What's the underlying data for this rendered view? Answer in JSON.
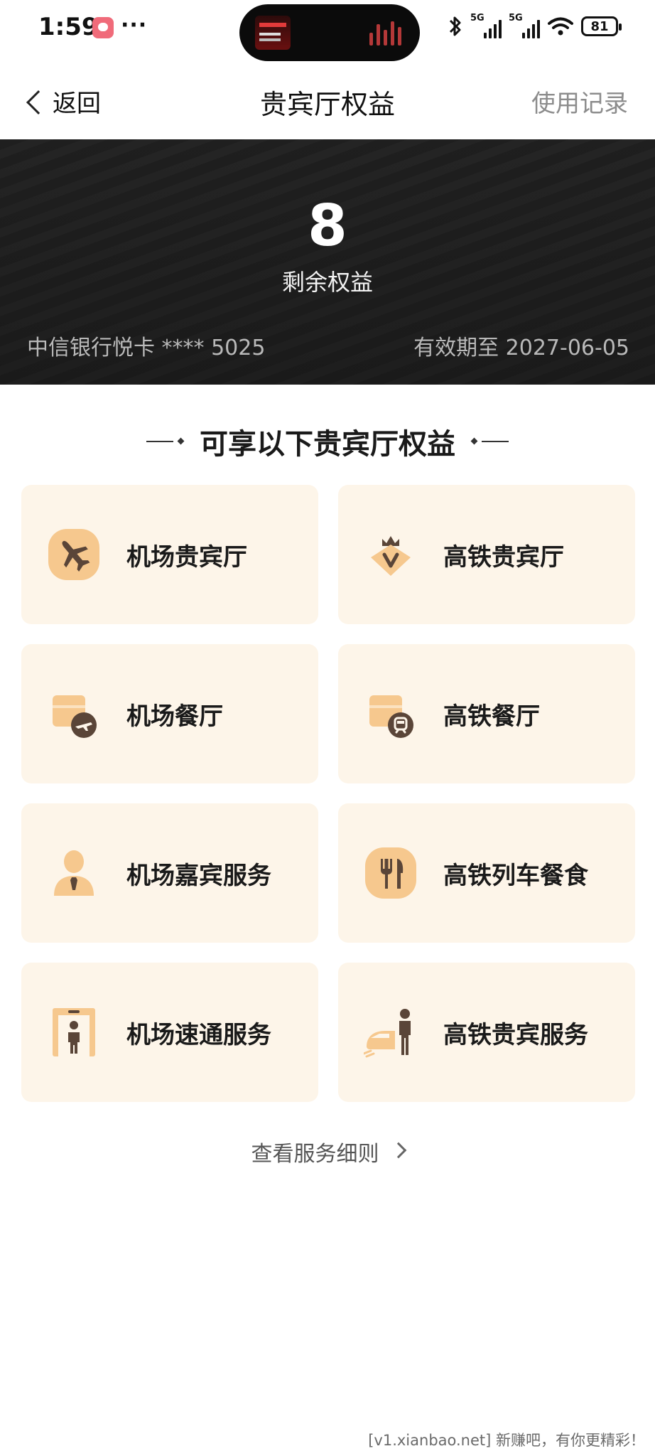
{
  "status_bar": {
    "time": "1:59",
    "more": "···",
    "signal_1": "5G",
    "signal_2": "5G",
    "battery": "81",
    "icons": [
      "bluetooth-icon",
      "signal-icon",
      "wifi-icon",
      "battery-icon"
    ]
  },
  "nav": {
    "back_label": "返回",
    "title": "贵宾厅权益",
    "right_link": "使用记录"
  },
  "summary": {
    "remaining_count": "8",
    "remaining_label": "剩余权益",
    "card_info": "中信银行悦卡 **** 5025",
    "expiry": "有效期至 2027-06-05"
  },
  "section": {
    "title": "可享以下贵宾厅权益"
  },
  "benefits": [
    {
      "label": "机场贵宾厅",
      "icon": "airplane-icon"
    },
    {
      "label": "高铁贵宾厅",
      "icon": "v-crown-icon"
    },
    {
      "label": "机场餐厅",
      "icon": "restaurant-plane-icon"
    },
    {
      "label": "高铁餐厅",
      "icon": "restaurant-train-icon"
    },
    {
      "label": "机场嘉宾服务",
      "icon": "concierge-person-icon"
    },
    {
      "label": "高铁列车餐食",
      "icon": "fork-knife-icon"
    },
    {
      "label": "机场速通服务",
      "icon": "fast-track-gate-icon"
    },
    {
      "label": "高铁贵宾服务",
      "icon": "train-person-icon"
    }
  ],
  "footer": {
    "rules_link": "查看服务细则"
  },
  "watermark": "[v1.xianbao.net] 新赚吧，有你更精彩！",
  "colors": {
    "tile_background": "#fdf5e9",
    "icon_accent": "#f6c88e",
    "icon_dark": "#5a4538",
    "hero_background": "#242424"
  }
}
